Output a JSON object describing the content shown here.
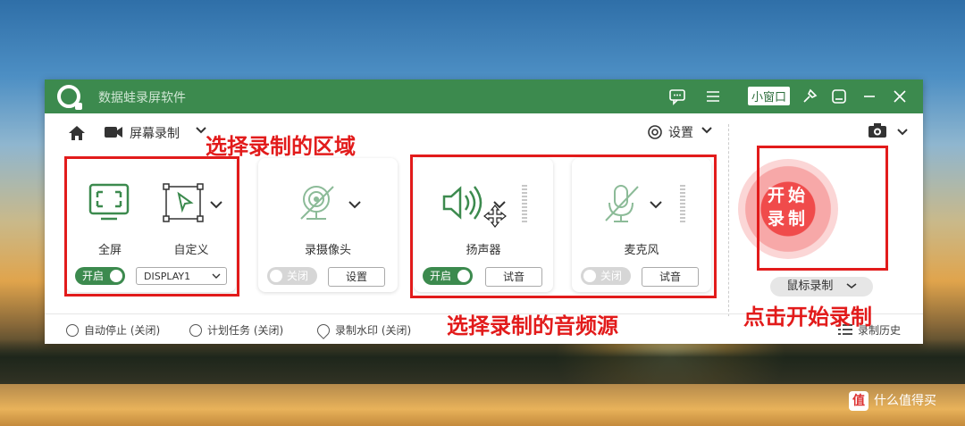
{
  "app": {
    "title": "数据蛙录屏软件",
    "mini_window": "小窗口"
  },
  "toolbar": {
    "mode": "屏幕录制",
    "settings": "设置"
  },
  "area": {
    "fullscreen": "全屏",
    "custom": "自定义",
    "toggle": "开启",
    "display": "DISPLAY1"
  },
  "camera": {
    "label": "录摄像头",
    "toggle": "关闭",
    "button": "设置"
  },
  "speaker": {
    "label": "扬声器",
    "toggle": "开启",
    "button": "试音"
  },
  "mic": {
    "label": "麦克风",
    "toggle": "关闭",
    "button": "试音"
  },
  "record": {
    "start_line1": "开始",
    "start_line2": "录制",
    "mouse_mode": "鼠标录制"
  },
  "bottom": {
    "auto_stop": "自动停止 (关闭)",
    "schedule": "计划任务 (关闭)",
    "watermark": "录制水印 (关闭)",
    "history": "录制历史"
  },
  "annotations": {
    "select_area": "选择录制的区域",
    "select_audio": "选择录制的音频源",
    "click_start": "点击开始录制"
  },
  "overlay": {
    "site": "什么值得买"
  },
  "colors": {
    "brand_green": "#3c8a4e",
    "record_red": "#f04b4b",
    "annotation_red": "#e21b1b"
  }
}
